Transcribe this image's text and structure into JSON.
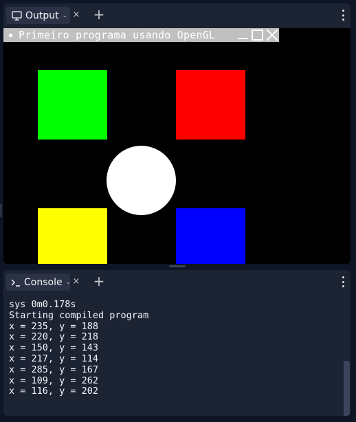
{
  "output_pane": {
    "tab_label": "Output",
    "tab_icon": "monitor-icon",
    "close_symbol": "×",
    "add_symbol": "+",
    "gl_window": {
      "title": "Primeiro programa usando OpenGL",
      "shapes": [
        {
          "name": "green-square",
          "color": "#00ff00"
        },
        {
          "name": "red-square",
          "color": "#ff0000"
        },
        {
          "name": "white-circle",
          "color": "#ffffff"
        },
        {
          "name": "yellow-square",
          "color": "#ffff00"
        },
        {
          "name": "blue-square",
          "color": "#0000ff"
        }
      ]
    }
  },
  "console_pane": {
    "tab_label": "Console",
    "tab_icon": "terminal-prompt-icon",
    "close_symbol": "×",
    "add_symbol": "+",
    "lines": [
      "sys 0m0.178s",
      "Starting compiled program",
      "x = 235, y = 188",
      "x = 220, y = 218",
      "x = 150, y = 143",
      "x = 217, y = 114",
      "x = 285, y = 167",
      "x = 109, y = 262",
      "x = 116, y = 202"
    ]
  }
}
